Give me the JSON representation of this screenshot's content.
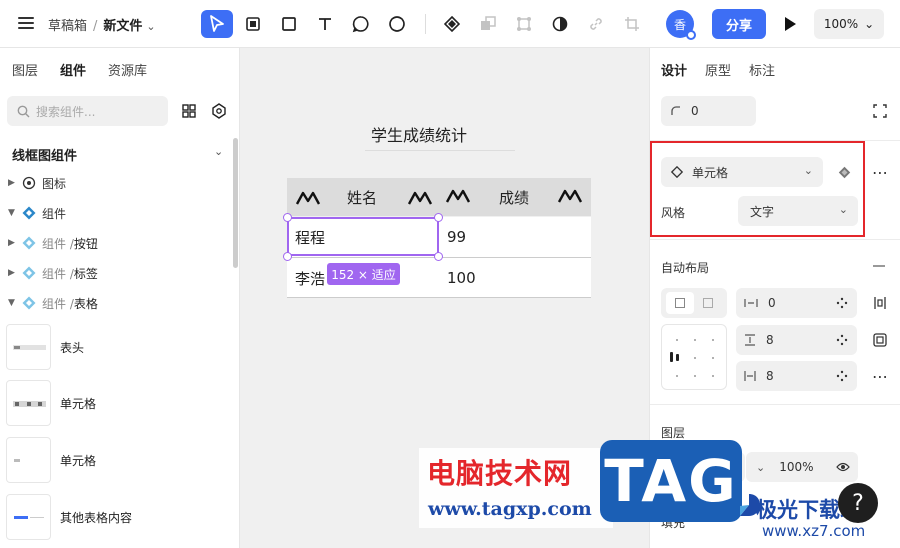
{
  "topbar": {
    "breadcrumb_folder": "草稿箱",
    "breadcrumb_sep": "/",
    "file_name": "新文件",
    "file_chevron": "⌄",
    "avatar_text": "香",
    "share_label": "分享",
    "zoom_label": "100%",
    "zoom_chevron": "⌄",
    "tools": [
      "move-tool-icon",
      "frame-tool-icon",
      "rectangle-tool-icon",
      "text-tool-icon",
      "comment-tool-icon",
      "shape-tool-icon",
      "component-icon",
      "boolean-icon",
      "bounding-icon",
      "mask-icon",
      "link-icon",
      "crop-icon"
    ],
    "accent_color": "#3d6ef5"
  },
  "left_panel": {
    "tabs": [
      {
        "label": "图层"
      },
      {
        "label": "组件",
        "active": true
      },
      {
        "label": "资源库"
      }
    ],
    "search_placeholder": "搜索组件...",
    "section_title": "线框图组件",
    "tree": [
      {
        "label": "图标",
        "expanded": false
      },
      {
        "label": "组件",
        "expanded": true
      },
      {
        "prefix": "组件 / ",
        "label": "按钮",
        "expanded": false
      },
      {
        "prefix": "组件 / ",
        "label": "标签",
        "expanded": false
      },
      {
        "prefix": "组件 / ",
        "label": "表格",
        "expanded": true
      }
    ],
    "components": [
      {
        "label": "表头"
      },
      {
        "label": "单元格"
      },
      {
        "label": "单元格"
      },
      {
        "label": "其他表格内容"
      }
    ]
  },
  "canvas": {
    "title": "学生成绩统计",
    "table": {
      "headers": [
        "姓名",
        "成绩"
      ],
      "rows": [
        [
          "程程",
          "99"
        ],
        [
          "李浩",
          "100"
        ]
      ]
    },
    "selection_badge": "152 × 适应",
    "selection_color": "#a066f0"
  },
  "right_panel": {
    "tabs": [
      {
        "label": "设计",
        "active": true
      },
      {
        "label": "原型"
      },
      {
        "label": "标注"
      }
    ],
    "corner_radius": "0",
    "component_name": "单元格",
    "style_label": "风格",
    "style_value": "文字",
    "auto_layout_label": "自动布局",
    "gap_value": "0",
    "padding_v": "8",
    "padding_h": "8",
    "layer_label": "图层",
    "layer_opacity": "100%",
    "fill_label": "填充",
    "highlight_color": "#e4262b"
  },
  "overlays": {
    "watermark_cn": "电脑技术网",
    "watermark_url": "www.tagxp.com",
    "tag_logo": "TAG",
    "help_label": "?",
    "jiguang_cn": "极光下载站",
    "jiguang_url": "www.xz7.com"
  }
}
